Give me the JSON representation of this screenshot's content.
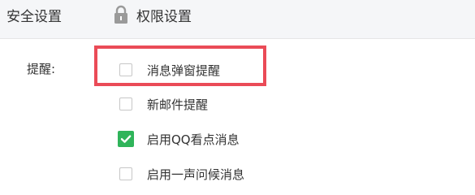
{
  "tabs": [
    {
      "label": "安全设置",
      "icon": ""
    },
    {
      "label": "权限设置",
      "icon": "lock-icon"
    }
  ],
  "reminder": {
    "label": "提醒:",
    "options": [
      {
        "label": "消息弹窗提醒",
        "checked": false
      },
      {
        "label": "新邮件提醒",
        "checked": false
      },
      {
        "label": "启用QQ看点消息",
        "checked": true
      },
      {
        "label": "启用一声问候消息",
        "checked": false
      }
    ]
  },
  "colors": {
    "check_green": "#2fb45a",
    "highlight_red": "#ea4b57"
  }
}
